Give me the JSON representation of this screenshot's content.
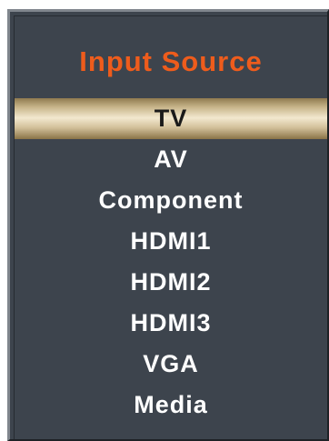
{
  "menu": {
    "title": "Input Source",
    "selected_index": 0,
    "items": [
      {
        "label": "TV"
      },
      {
        "label": "AV"
      },
      {
        "label": "Component"
      },
      {
        "label": "HDMI1"
      },
      {
        "label": "HDMI2"
      },
      {
        "label": "HDMI3"
      },
      {
        "label": "VGA"
      },
      {
        "label": "Media"
      }
    ]
  },
  "colors": {
    "panel_background": "#3d444d",
    "title_color": "#ee5c1c",
    "item_text": "#ffffff",
    "selected_text": "#1a1a1a",
    "selected_highlight": "#f2e8cf"
  }
}
